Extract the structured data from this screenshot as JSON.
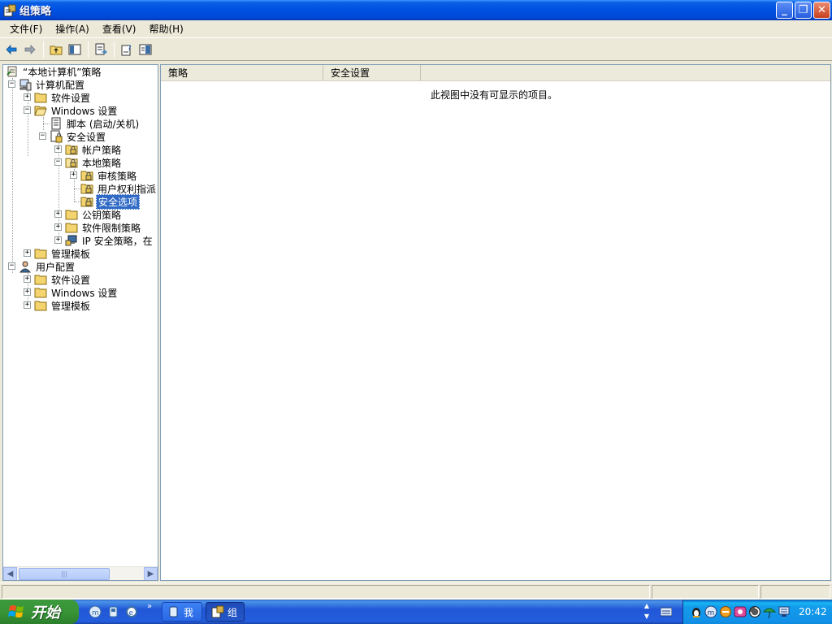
{
  "window": {
    "title": "组策略"
  },
  "menu": [
    {
      "label": "文件(F)"
    },
    {
      "label": "操作(A)"
    },
    {
      "label": "查看(V)"
    },
    {
      "label": "帮助(H)"
    }
  ],
  "toolbar": {
    "icons": [
      "back-arrow-icon",
      "forward-arrow-icon",
      "up-folder-icon",
      "show-hide-tree-icon",
      "export-list-icon",
      "properties-icon",
      "help-icon"
    ]
  },
  "tree": {
    "root": "“本地计算机”策略",
    "computer_config": "计算机配置",
    "software_settings": "软件设置",
    "windows_settings": "Windows 设置",
    "scripts": "脚本 (启动/关机)",
    "security_settings": "安全设置",
    "account_policies": "帐户策略",
    "local_policies": "本地策略",
    "audit_policy": "审核策略",
    "user_rights": "用户权利指派",
    "security_options": "安全选项",
    "public_key": "公钥策略",
    "software_restriction": "软件限制策略",
    "ip_security": "IP 安全策略，在",
    "admin_templates": "管理模板",
    "user_config": "用户配置",
    "user_software_settings": "软件设置",
    "user_windows_settings": "Windows 设置",
    "user_admin_templates": "管理模板"
  },
  "detail": {
    "columns": [
      "策略",
      "安全设置"
    ],
    "empty_message": "此视图中没有可显示的项目。"
  },
  "taskbar": {
    "start_label": "开始",
    "tasks": [
      {
        "label": "我"
      },
      {
        "label": "组"
      }
    ],
    "clock": "20:42"
  },
  "colors": {
    "title_bar": "#0054E3",
    "selection": "#316AC5",
    "start_button": "#379537",
    "tray": "#1290E8"
  }
}
